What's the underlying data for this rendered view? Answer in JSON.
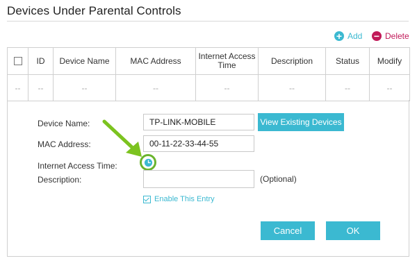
{
  "page": {
    "title": "Devices Under Parental Controls"
  },
  "toolbar": {
    "add_label": "Add",
    "delete_label": "Delete",
    "add_icon": "plus-circle-icon",
    "delete_icon": "minus-circle-icon"
  },
  "table": {
    "columns": [
      "ID",
      "Device Name",
      "MAC Address",
      "Internet Access Time",
      "Description",
      "Status",
      "Modify"
    ],
    "empty_row": [
      "--",
      "--",
      "--",
      "--",
      "--",
      "--",
      "--",
      "--"
    ]
  },
  "form": {
    "device_name_label": "Device Name:",
    "device_name_value": "TP-LINK-MOBILE",
    "view_devices_label": "View Existing Devices",
    "mac_label": "MAC Address:",
    "mac_value": "00-11-22-33-44-55",
    "access_time_label": "Internet Access Time:",
    "access_time_icon": "clock-icon",
    "description_label": "Description:",
    "description_value": "",
    "optional_hint": "(Optional)",
    "enable_label": "Enable This Entry",
    "enable_checked": true,
    "cancel_label": "Cancel",
    "ok_label": "OK"
  },
  "colors": {
    "accent": "#3bb9d1",
    "delete": "#c11a59",
    "highlight": "#6ab42d"
  }
}
